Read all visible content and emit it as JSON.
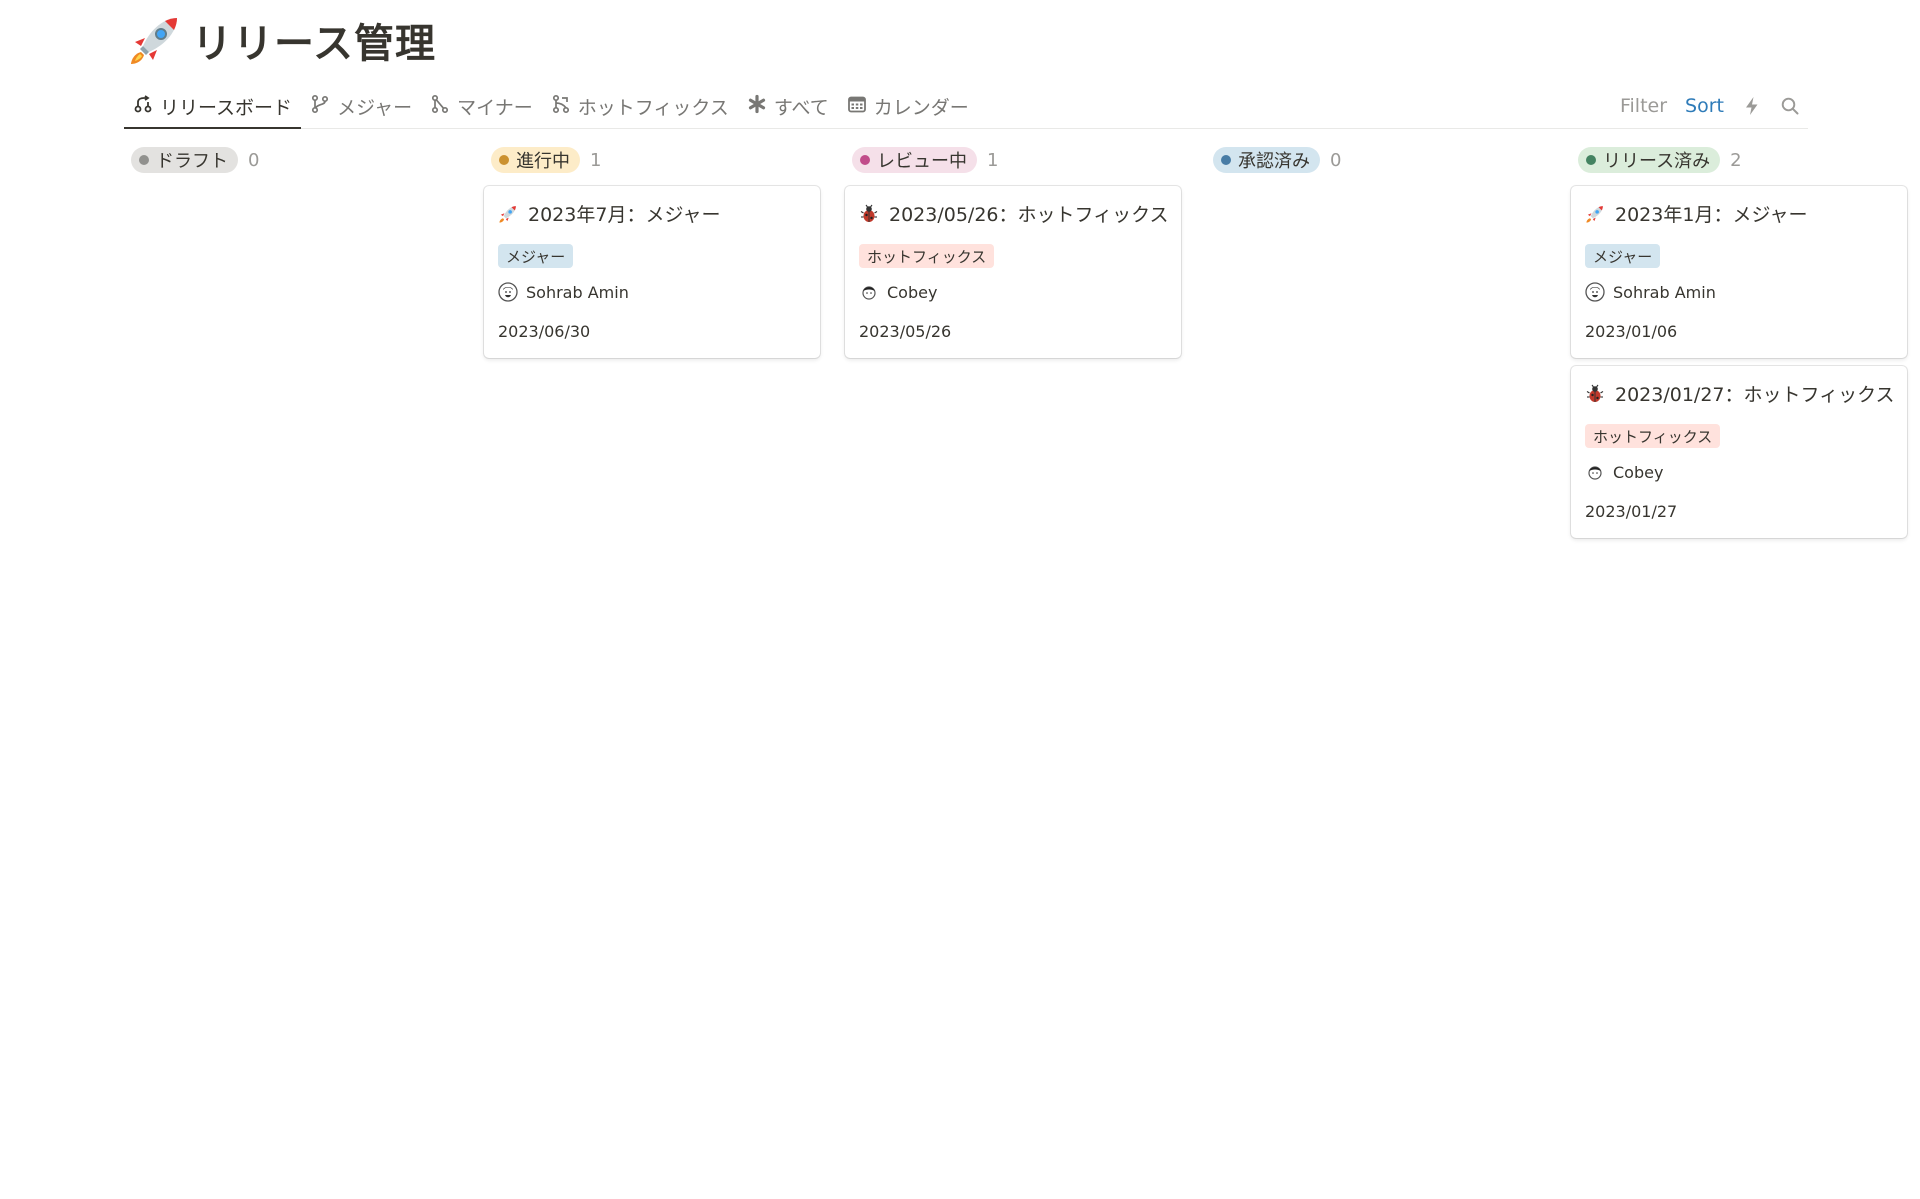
{
  "page": {
    "title": "リリース管理",
    "title_icon": "rocket-icon"
  },
  "tabs": [
    {
      "label": "リリースボード",
      "icon": "board-icon",
      "active": true
    },
    {
      "label": "メジャー",
      "icon": "branch-icon",
      "active": false
    },
    {
      "label": "マイナー",
      "icon": "minor-branch-icon",
      "active": false
    },
    {
      "label": "ホットフィックス",
      "icon": "merge-icon",
      "active": false
    },
    {
      "label": "すべて",
      "icon": "asterisk-icon",
      "active": false
    },
    {
      "label": "カレンダー",
      "icon": "calendar-icon",
      "active": false
    }
  ],
  "toolbar": {
    "filter_label": "Filter",
    "sort_label": "Sort",
    "automation_icon": "lightning-icon",
    "search_icon": "search-icon"
  },
  "columns": [
    {
      "label": "ドラフト",
      "count": "0",
      "pill_color": "#e3e2e0",
      "dot_color": "#91918e",
      "cards": []
    },
    {
      "label": "進行中",
      "count": "1",
      "pill_color": "#fdecc8",
      "dot_color": "#cb912f",
      "cards": [
        {
          "title": "2023年7月：メジャー",
          "icon": "rocket-icon",
          "tag": "メジャー",
          "tag_type": "major",
          "person": "Sohrab Amin",
          "date": "2023/06/30"
        }
      ]
    },
    {
      "label": "レビュー中",
      "count": "1",
      "pill_color": "#f5e0e9",
      "dot_color": "#c14c8a",
      "cards": [
        {
          "title": "2023/05/26：ホットフィックス",
          "icon": "bug-icon",
          "tag": "ホットフィックス",
          "tag_type": "hotfix",
          "person": "Cobey",
          "date": "2023/05/26"
        }
      ]
    },
    {
      "label": "承認済み",
      "count": "0",
      "pill_color": "#d3e5ef",
      "dot_color": "#487ca5",
      "cards": []
    },
    {
      "label": "リリース済み",
      "count": "2",
      "pill_color": "#dbeddb",
      "dot_color": "#448361",
      "cards": [
        {
          "title": "2023年1月：メジャー",
          "icon": "rocket-icon",
          "tag": "メジャー",
          "tag_type": "major",
          "person": "Sohrab Amin",
          "date": "2023/01/06"
        },
        {
          "title": "2023/01/27：ホットフィックス",
          "icon": "bug-icon",
          "tag": "ホットフィックス",
          "tag_type": "hotfix",
          "person": "Cobey",
          "date": "2023/01/27"
        }
      ]
    }
  ]
}
